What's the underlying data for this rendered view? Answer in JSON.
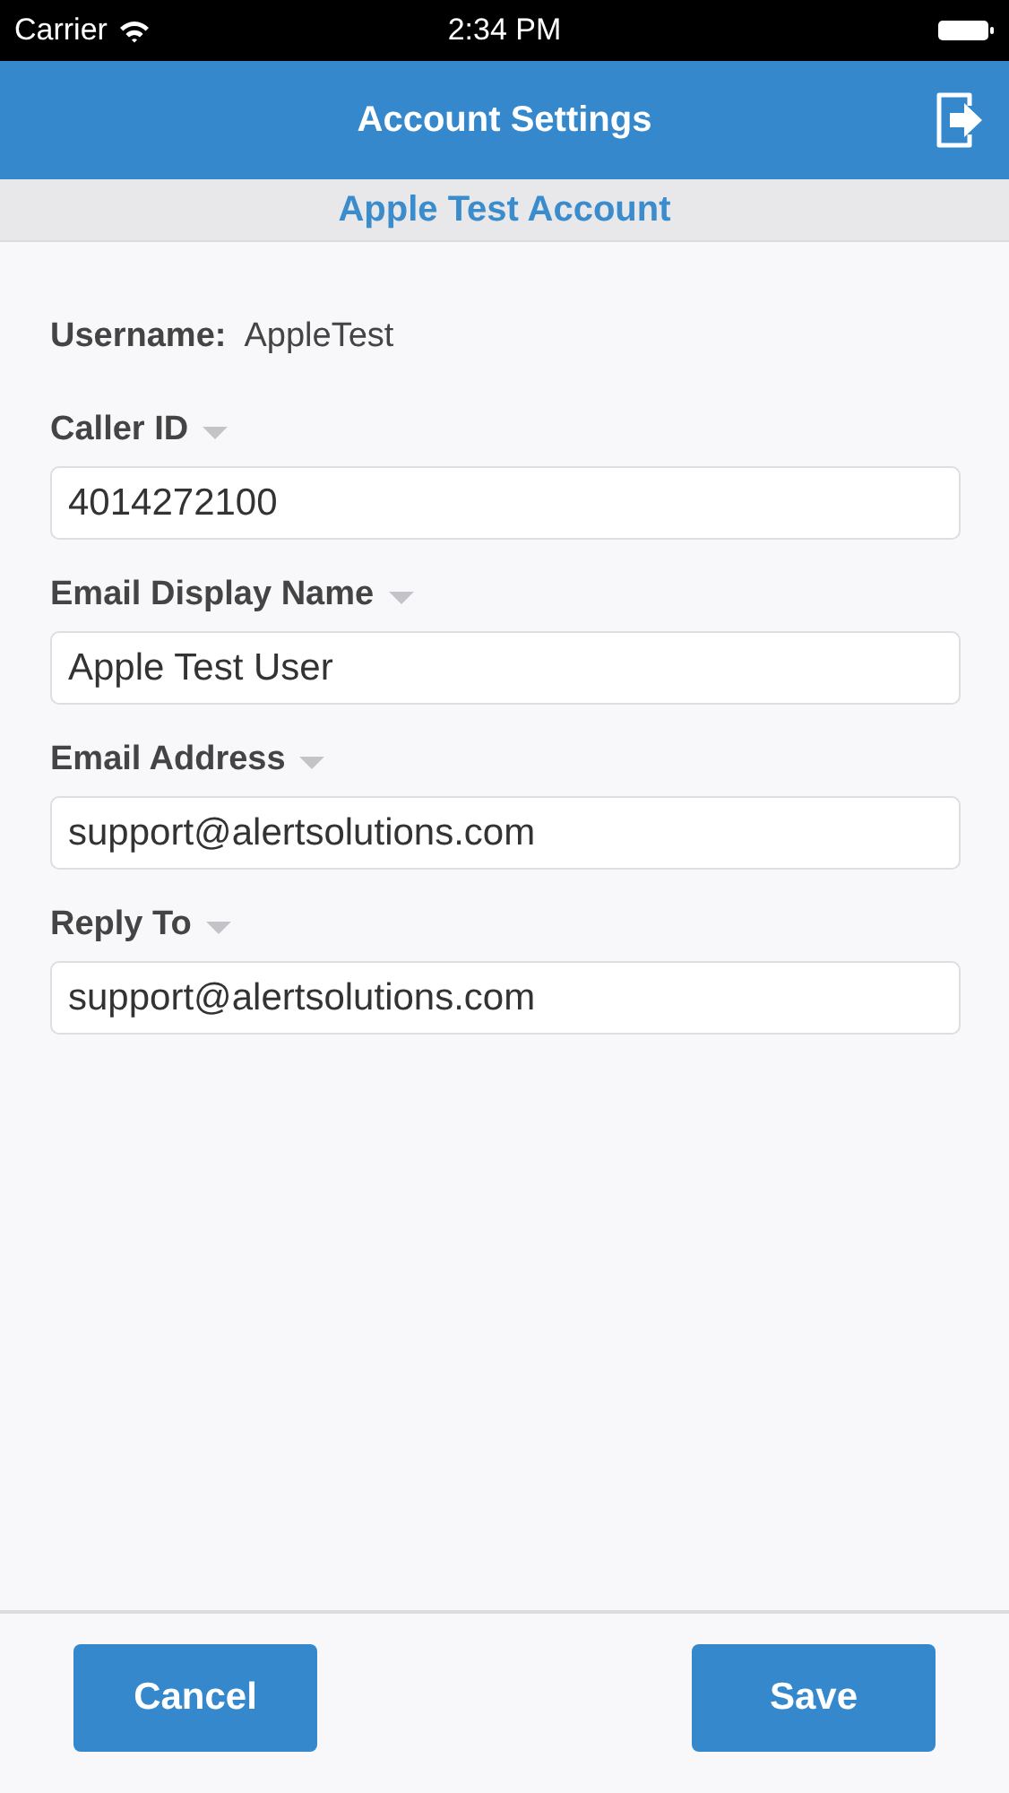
{
  "status_bar": {
    "carrier": "Carrier",
    "time": "2:34 PM"
  },
  "nav_bar": {
    "title": "Account Settings"
  },
  "account_name": "Apple Test Account",
  "username": {
    "label": "Username:",
    "value": "AppleTest"
  },
  "fields": [
    {
      "label": "Caller ID",
      "value": "4014272100"
    },
    {
      "label": "Email Display Name",
      "value": "Apple Test User"
    },
    {
      "label": "Email Address",
      "value": "support@alertsolutions.com"
    },
    {
      "label": "Reply To",
      "value": "support@alertsolutions.com"
    }
  ],
  "buttons": [
    "Cancel",
    "Save"
  ]
}
